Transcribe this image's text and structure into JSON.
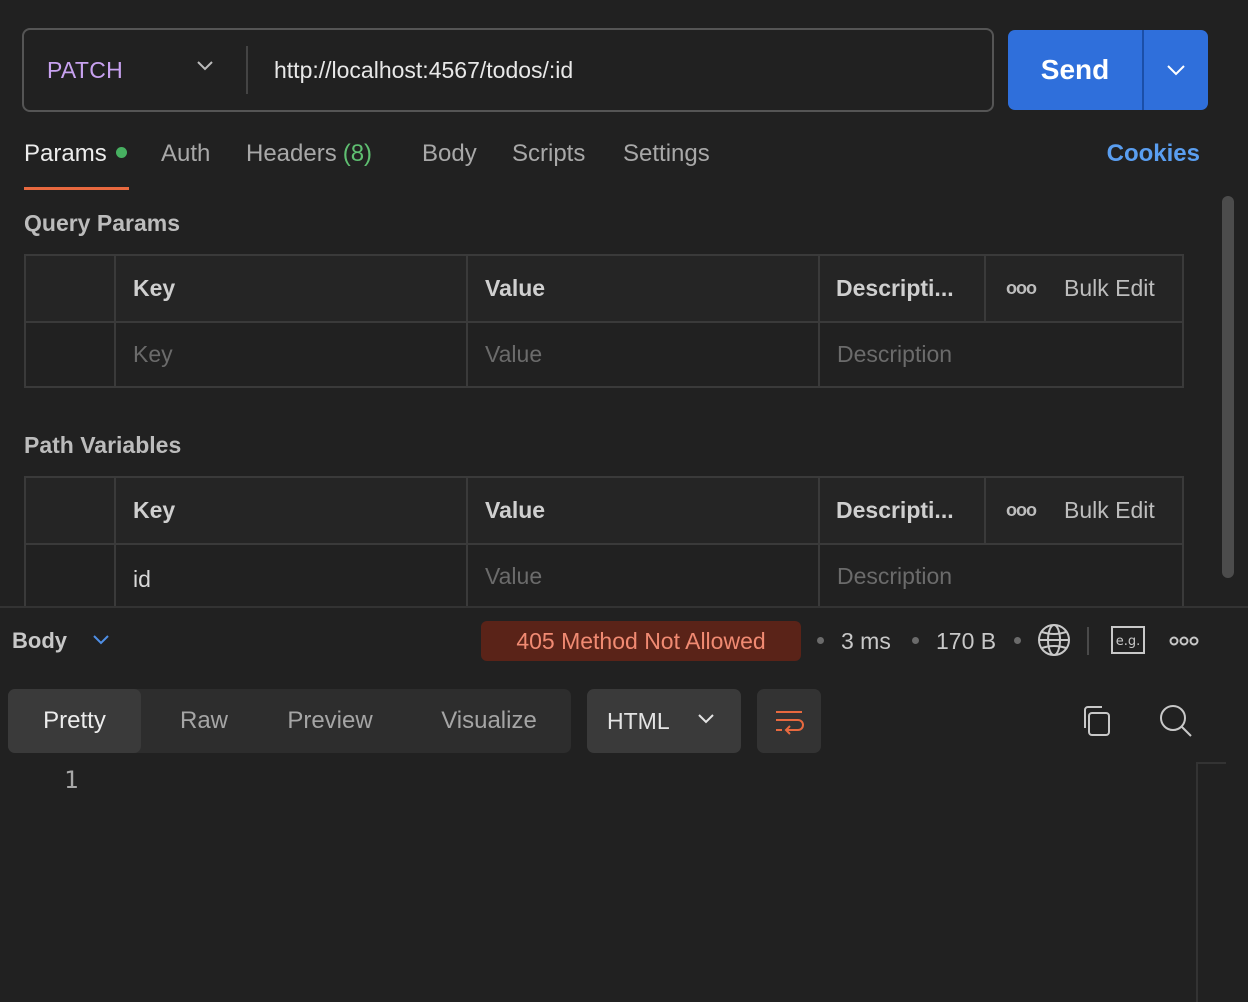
{
  "request": {
    "method": "PATCH",
    "url": "http://localhost:4567/todos/:id",
    "send_label": "Send"
  },
  "tabs": {
    "params": "Params",
    "auth": "Auth",
    "headers": "Headers",
    "headers_count": "(8)",
    "body": "Body",
    "scripts": "Scripts",
    "settings": "Settings",
    "cookies": "Cookies"
  },
  "query_params": {
    "title": "Query Params",
    "headers": {
      "key": "Key",
      "value": "Value",
      "description": "Descripti...",
      "bulk_edit": "Bulk Edit"
    },
    "new_row": {
      "key_placeholder": "Key",
      "value_placeholder": "Value",
      "description_placeholder": "Description"
    }
  },
  "path_variables": {
    "title": "Path Variables",
    "headers": {
      "key": "Key",
      "value": "Value",
      "description": "Descripti...",
      "bulk_edit": "Bulk Edit"
    },
    "rows": [
      {
        "key": "id",
        "value_placeholder": "Value",
        "description_placeholder": "Description"
      }
    ]
  },
  "response": {
    "body_label": "Body",
    "status": "405 Method Not Allowed",
    "time": "3 ms",
    "size": "170 B",
    "view_tabs": [
      "Pretty",
      "Raw",
      "Preview",
      "Visualize"
    ],
    "format": "HTML",
    "line_numbers": [
      "1"
    ]
  },
  "colors": {
    "method": "#c8a2f0",
    "send": "#2f6fdb",
    "active_tab_underline": "#e8693f",
    "status_bg": "#5a2318",
    "status_text": "#f08a72",
    "cookies": "#5a9ef0"
  }
}
